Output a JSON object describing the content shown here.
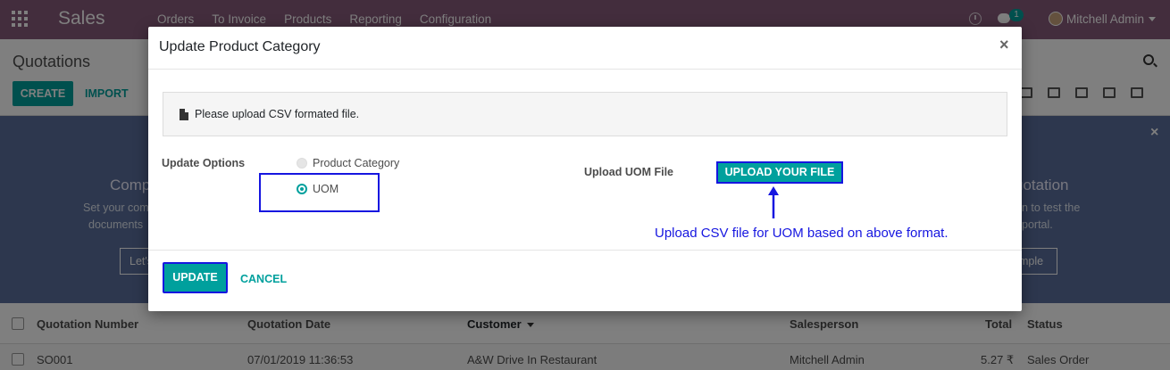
{
  "navbar": {
    "apps_icon": "apps-grid-icon",
    "brand": "Sales",
    "menu": [
      "Orders",
      "To Invoice",
      "Products",
      "Reporting",
      "Configuration"
    ],
    "chat_badge": "1",
    "user_name": "Mitchell Admin"
  },
  "control_panel": {
    "title": "Quotations",
    "create_label": "CREATE",
    "import_label": "IMPORT"
  },
  "helper": {
    "left_title": "Comp",
    "left_line1": "Set your com",
    "left_line2": "documents",
    "left_button": "Let's",
    "right_title": "uotation",
    "right_line1": "n to test the",
    "right_line2": "portal.",
    "right_button": "mple"
  },
  "list": {
    "columns": {
      "number": "Quotation Number",
      "date": "Quotation Date",
      "customer": "Customer",
      "salesperson": "Salesperson",
      "total": "Total",
      "status": "Status"
    },
    "rows": [
      {
        "number": "SO001",
        "date": "07/01/2019 11:36:53",
        "customer": "A&W Drive In Restaurant",
        "salesperson": "Mitchell Admin",
        "total": "5.27 ₹",
        "status": "Sales Order"
      }
    ]
  },
  "modal": {
    "title": "Update Product Category",
    "close_symbol": "×",
    "info_text": "Please upload CSV formated file.",
    "update_options_label": "Update Options",
    "options": [
      "Product Category",
      "UOM"
    ],
    "selected_option": "UOM",
    "upload_label": "Upload UOM File",
    "upload_button": "UPLOAD YOUR FILE",
    "annotation": "Upload CSV file for UOM based on above format.",
    "update_button": "UPDATE",
    "cancel_button": "CANCEL"
  },
  "colors": {
    "navbar": "#875a7b",
    "accent": "#00a09d",
    "annotation": "#1616e0"
  }
}
